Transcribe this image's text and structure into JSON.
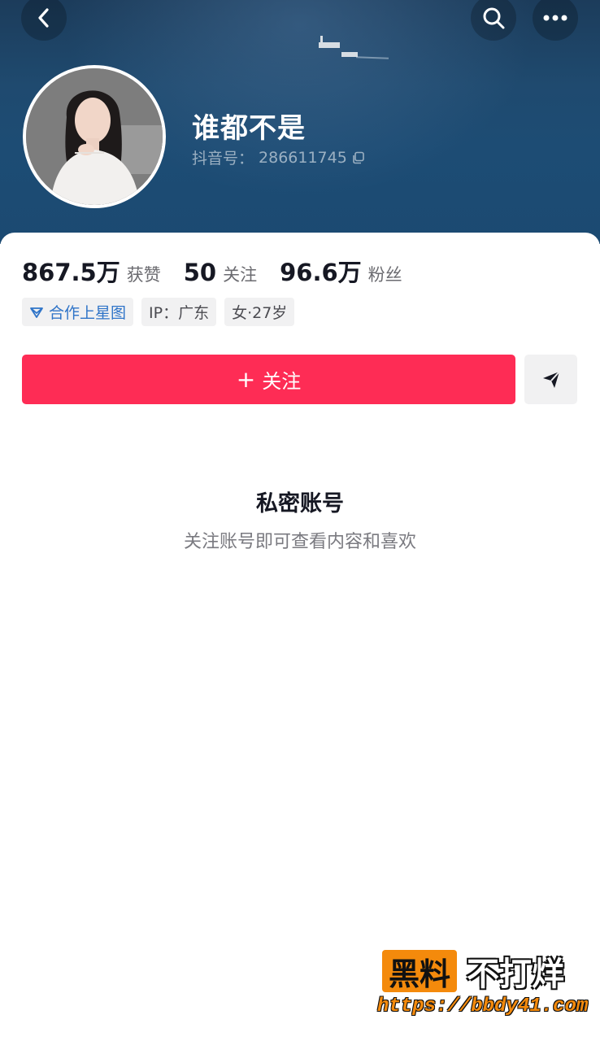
{
  "profile": {
    "name": "谁都不是",
    "douyin_id_label": "抖音号：",
    "douyin_id": "286611745"
  },
  "stats": [
    {
      "value": "867.5万",
      "label": "获赞"
    },
    {
      "value": "50",
      "label": "关注"
    },
    {
      "value": "96.6万",
      "label": "粉丝"
    }
  ],
  "tags": [
    {
      "label": "合作上星图",
      "icon": "xingtu-icon"
    },
    {
      "label": "IP：广东"
    },
    {
      "label": "女·27岁"
    }
  ],
  "actions": {
    "follow_plus": "+",
    "follow_label": "关注",
    "message_icon": "send-icon"
  },
  "private": {
    "title": "私密账号",
    "subtitle": "关注账号即可查看内容和喜欢"
  },
  "watermark": {
    "brand_box": "黑料",
    "brand_text": "不打烊",
    "url": "https://bbdy41.com"
  },
  "colors": {
    "accent": "#fe2c55",
    "tag_blue": "#2f74c8",
    "watermark_orange": "#f48a0c"
  }
}
